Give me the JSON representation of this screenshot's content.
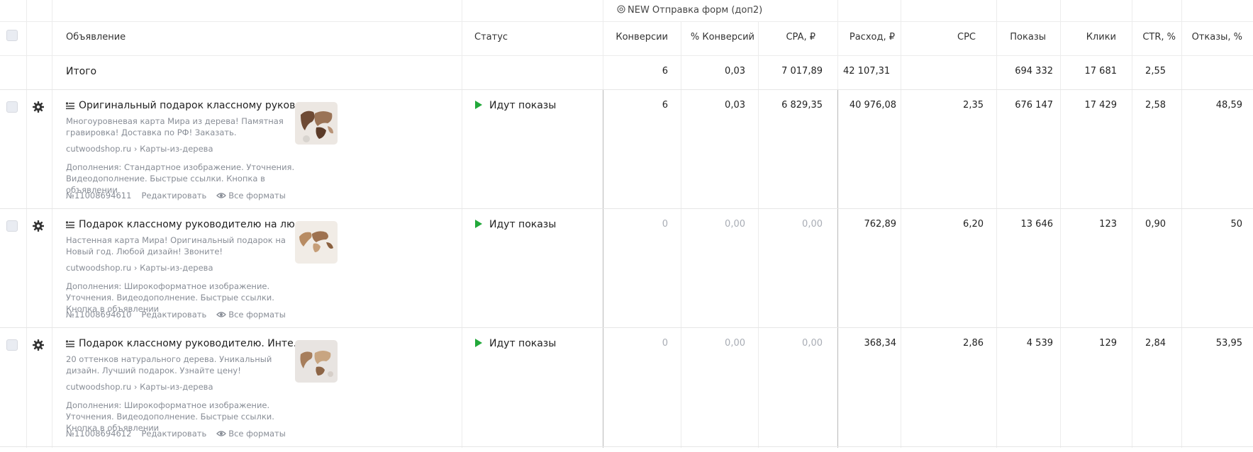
{
  "goal_header": "NEW Отправка форм (доп2)",
  "columns": {
    "ad": "Объявление",
    "status": "Статус",
    "conversions": "Конверсии",
    "conv_pct": "% Конверсий",
    "cpa": "CPA, ₽",
    "spend": "Расход, ₽",
    "cpc": "CPC",
    "impressions": "Показы",
    "clicks": "Клики",
    "ctr": "CTR, %",
    "bounces": "Отказы, %"
  },
  "total": {
    "label": "Итого",
    "conversions": "6",
    "conv_pct": "0,03",
    "cpa": "7 017,89",
    "spend": "42 107,31",
    "cpc": "",
    "impressions": "694 332",
    "clicks": "17 681",
    "ctr": "2,55",
    "bounces": ""
  },
  "ads": [
    {
      "title": "Оригинальный подарок классному руков...",
      "text": "Многоуровневая карта Мира из дерева! Памятная гравировка! Доставка по РФ! Заказать.",
      "domain": "cutwoodshop.ru › Карты-из-дерева",
      "extensions": "Дополнения: Стандартное изображение. Уточнения. Видеодополнение. Быстрые ссылки. Кнопка в объявлении",
      "id": "№11008694611",
      "edit": "Редактировать",
      "formats": "Все форматы",
      "status": "Идут показы",
      "conversions": "6",
      "conv_pct": "0,03",
      "cpa": "6 829,35",
      "spend": "40 976,08",
      "cpc": "2,35",
      "impressions": "676 147",
      "clicks": "17 429",
      "ctr": "2,58",
      "bounces": "48,59",
      "muted_conv": false
    },
    {
      "title": "Подарок классному руководителю на лю...",
      "text": "Настенная карта Мира! Оригинальный подарок на Новый год. Любой дизайн! Звоните!",
      "domain": "cutwoodshop.ru › Карты-из-дерева",
      "extensions": "Дополнения: Широкоформатное изображение. Уточнения. Видеодополнение. Быстрые ссылки. Кнопка в объявлении",
      "id": "№11008694610",
      "edit": "Редактировать",
      "formats": "Все форматы",
      "status": "Идут показы",
      "conversions": "0",
      "conv_pct": "0,00",
      "cpa": "0,00",
      "spend": "762,89",
      "cpc": "6,20",
      "impressions": "13 646",
      "clicks": "123",
      "ctr": "0,90",
      "bounces": "50",
      "muted_conv": true
    },
    {
      "title": "Подарок классному руководителю. Инте...",
      "text": "20 оттенков натурального дерева. Уникальный дизайн. Лучший подарок. Узнайте цену!",
      "domain": "cutwoodshop.ru › Карты-из-дерева",
      "extensions": "Дополнения: Широкоформатное изображение. Уточнения. Видеодополнение. Быстрые ссылки. Кнопка в объявлении",
      "id": "№11008694612",
      "edit": "Редактировать",
      "formats": "Все форматы",
      "status": "Идут показы",
      "conversions": "0",
      "conv_pct": "0,00",
      "cpa": "0,00",
      "spend": "368,34",
      "cpc": "2,86",
      "impressions": "4 539",
      "clicks": "129",
      "ctr": "2,84",
      "bounces": "53,95",
      "muted_conv": true
    }
  ],
  "icons": {
    "goal": "target-icon",
    "row_settings": "gear-icon",
    "ad_type": "text-ad-icon",
    "status": "play-icon",
    "formats": "eye-icon"
  },
  "colors": {
    "status_green": "#22a83a",
    "muted_text": "#888d96",
    "muted_number": "#a9adb5"
  }
}
